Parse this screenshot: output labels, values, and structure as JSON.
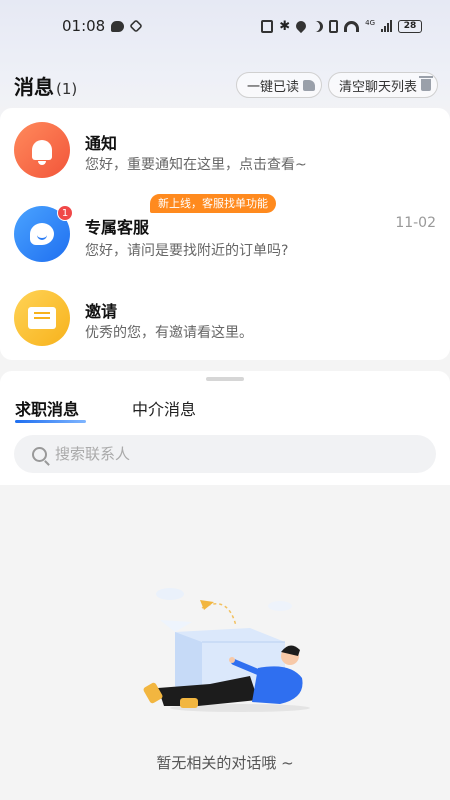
{
  "status_bar": {
    "time": "01:08",
    "network": "4G",
    "battery": "28"
  },
  "header": {
    "title": "消息",
    "count": "(1)",
    "mark_read_label": "一键已读",
    "clear_list_label": "清空聊天列表"
  },
  "messages": [
    {
      "name": "通知",
      "text": "您好，重要通知在这里，点击查看~",
      "icon": "bell-icon"
    },
    {
      "name": "专属客服",
      "text": "您好，请问是要找附近的订单吗?",
      "time": "11-02",
      "badge": "1",
      "tag": "新上线，客服找单功能",
      "icon": "chat-face-icon"
    },
    {
      "name": "邀请",
      "text": "优秀的您，有邀请看这里。",
      "icon": "envelope-icon"
    }
  ],
  "tabs": [
    {
      "label": "求职消息",
      "active": true
    },
    {
      "label": "中介消息",
      "active": false
    }
  ],
  "search": {
    "placeholder": "搜索联系人"
  },
  "empty": {
    "text": "暂无相关的对话哦 ~"
  },
  "colors": {
    "accent": "#1f6ff0",
    "badge": "#f04848",
    "tag": "#ff8a1e"
  }
}
